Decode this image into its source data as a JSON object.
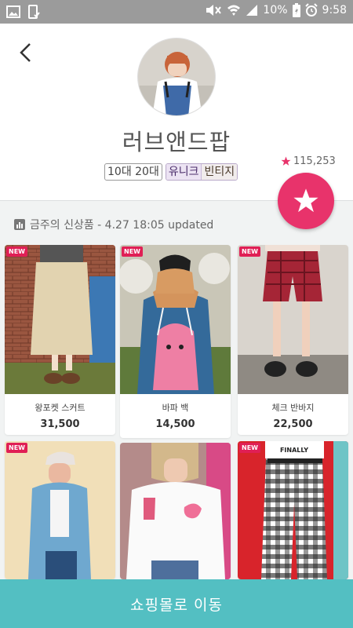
{
  "status_bar": {
    "battery": "10%",
    "time": "9:58"
  },
  "profile": {
    "shop_name": "러브앤드팝",
    "tags": [
      "10대 20대"
    ],
    "style_tags": [
      "유니크",
      "빈티지"
    ],
    "like_count": "115,253"
  },
  "section": {
    "label": "금주의 신상품 - 4.27 18:05 updated"
  },
  "products": [
    {
      "badge": "NEW",
      "name": "왕포켓 스커트",
      "price": "31,500"
    },
    {
      "badge": "NEW",
      "name": "바파 백",
      "price": "14,500"
    },
    {
      "badge": "NEW",
      "name": "체크 반바지",
      "price": "22,500"
    },
    {
      "badge": "NEW",
      "name": "",
      "price": ""
    },
    {
      "badge": "",
      "name": "",
      "price": ""
    },
    {
      "badge": "NEW",
      "name": "",
      "price": "",
      "print": "FINALLY"
    }
  ],
  "cta": {
    "label": "쇼핑몰로 이동"
  },
  "colors": {
    "accent": "#e8336b",
    "cta": "#53bfc2",
    "badge": "#e01f55"
  },
  "icons": [
    "image-icon",
    "phone-check-icon",
    "mute-icon",
    "wifi-icon",
    "signal-icon",
    "battery-icon",
    "alarm-icon",
    "back-arrow-icon",
    "star-icon",
    "chart-icon"
  ]
}
